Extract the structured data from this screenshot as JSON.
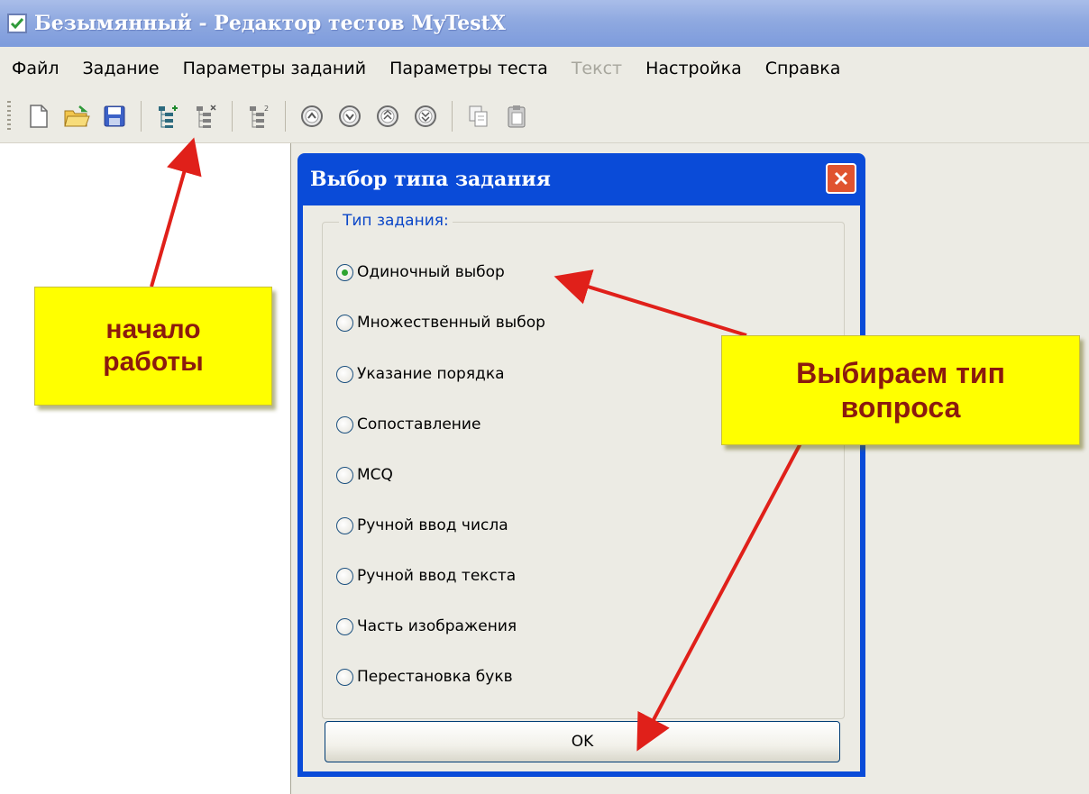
{
  "window": {
    "title": "Безымянный - Редактор тестов MyTestX"
  },
  "menu": [
    {
      "label": "Файл",
      "disabled": false
    },
    {
      "label": "Задание",
      "disabled": false
    },
    {
      "label": "Параметры заданий",
      "disabled": false
    },
    {
      "label": "Параметры теста",
      "disabled": false
    },
    {
      "label": "Текст",
      "disabled": true
    },
    {
      "label": "Настройка",
      "disabled": false
    },
    {
      "label": "Справка",
      "disabled": false
    }
  ],
  "toolbar": {
    "buttons": [
      "new-file-icon",
      "open-folder-icon",
      "save-icon",
      "add-task-icon",
      "delete-task-icon",
      "task-properties-icon",
      "move-first-icon",
      "move-down-icon",
      "move-up-icon",
      "move-last-icon",
      "copy-icon",
      "paste-icon"
    ]
  },
  "dialog": {
    "title": "Выбор типа задания",
    "group_label": "Тип задания:",
    "options": [
      "Одиночный выбор",
      "Множественный выбор",
      "Указание порядка",
      "Сопоставление",
      "MCQ",
      "Ручной ввод числа",
      "Ручной ввод текста",
      "Часть изображения",
      "Перестановка букв"
    ],
    "selected_option": "Одиночный выбор",
    "ok_label": "OK"
  },
  "annotations": {
    "start_label": "начало работы",
    "type_label": "Выбираем тип вопроса"
  },
  "colors": {
    "titlebar": "#8fa9e0",
    "dialog_frame": "#0a4bd8",
    "callout_bg": "#ffff00",
    "callout_text": "#8b1a0e",
    "arrow": "#e0201a"
  }
}
